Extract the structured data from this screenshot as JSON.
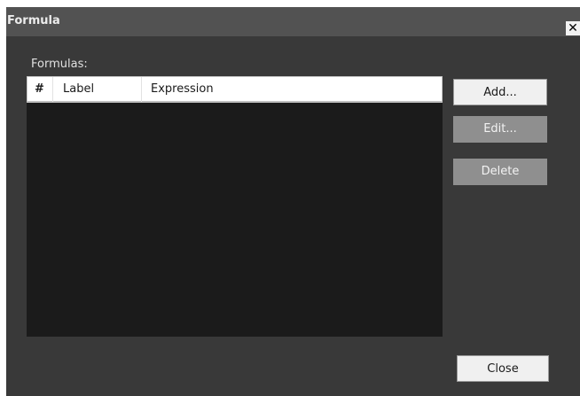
{
  "window": {
    "title": "Formula",
    "close_glyph": "✕"
  },
  "formulas": {
    "label": "Formulas:",
    "columns": [
      "#",
      "Label",
      "Expression"
    ],
    "rows": []
  },
  "buttons": {
    "add": "Add...",
    "edit": "Edit...",
    "delete": "Delete",
    "close": "Close"
  },
  "colors": {
    "window_bg": "#393939",
    "titlebar_bg": "#525252",
    "list_bg": "#1b1b1b",
    "disabled_button_bg": "#8f8f8f"
  },
  "state": {
    "edit_enabled": false,
    "delete_enabled": false
  },
  "icons": {
    "close": "close-icon"
  }
}
